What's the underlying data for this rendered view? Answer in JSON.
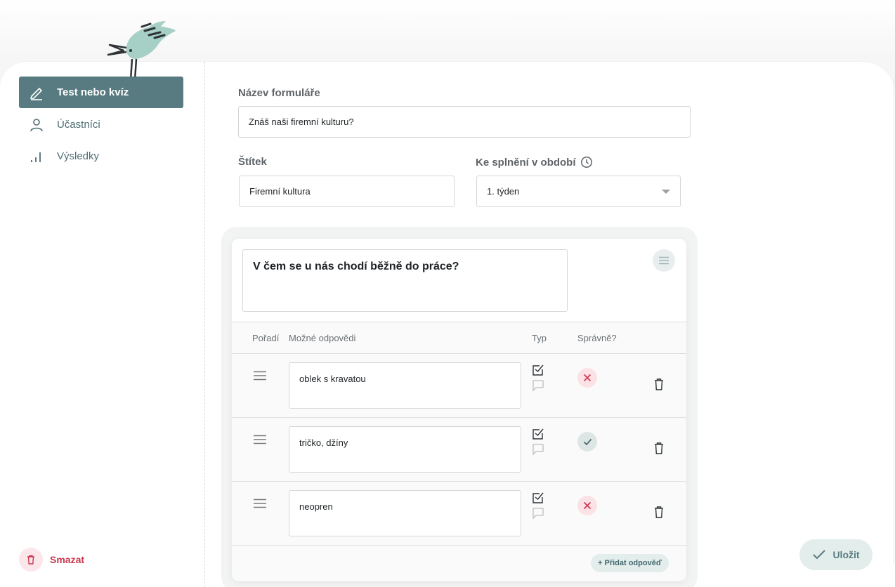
{
  "sidebar": {
    "items": [
      {
        "label": "Test nebo kvíz",
        "icon": "pencil-icon",
        "active": true
      },
      {
        "label": "Účastníci",
        "icon": "user-icon",
        "active": false
      },
      {
        "label": "Výsledky",
        "icon": "bar-chart-icon",
        "active": false
      }
    ],
    "delete_label": "Smazat"
  },
  "form": {
    "name_label": "Název formuláře",
    "name_value": "Znáš naši firemní kulturu?",
    "tag_label": "Štítek",
    "tag_value": "Firemní kultura",
    "period_label": "Ke splnění v období",
    "period_value": "1. týden"
  },
  "question": {
    "text": "V čem se u nás chodí běžně do práce?",
    "columns": {
      "order": "Pořadí",
      "answers": "Možné odpovědi",
      "type": "Typ",
      "correct": "Správně?"
    },
    "answers": [
      {
        "text": "oblek s kravatou",
        "correct": false
      },
      {
        "text": "tričko, džíny",
        "correct": true
      },
      {
        "text": "neopren",
        "correct": false
      }
    ],
    "add_answer_label": "+ Přidat odpověď"
  },
  "save_label": "Uložit",
  "colors": {
    "accent": "#587b81",
    "danger": "#c9374f",
    "success_bg": "#dde6e4",
    "danger_bg": "#fbe2e6"
  }
}
